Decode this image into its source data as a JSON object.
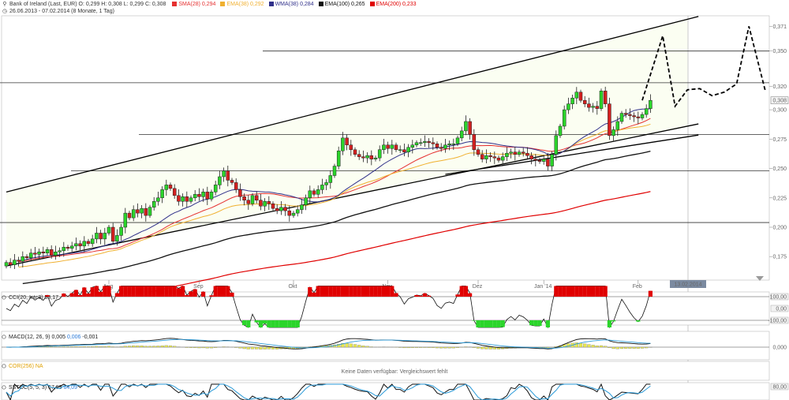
{
  "header": {
    "instrument": "Bank of Ireland (Last, EUR)",
    "ohlc": "O: 0,299  H: 0,308  L: 0,299  C: 0,308",
    "period": "26.06.2013 - 07.02.2014 (8 Monate, 1 Tag)",
    "indicators": [
      {
        "label": "SMA(28)",
        "value": "0,294",
        "color": "#e53030"
      },
      {
        "label": "EMA(38)",
        "value": "0,292",
        "color": "#f0b030"
      },
      {
        "label": "WMA(38)",
        "value": "0,284",
        "color": "#30308a"
      },
      {
        "label": "EMA(100)",
        "value": "0,265",
        "color": "#111111"
      },
      {
        "label": "EMA(200)",
        "value": "0,233",
        "color": "#e00000"
      }
    ]
  },
  "chart_data": [
    {
      "type": "candlestick",
      "name": "main",
      "ylim": [
        0.155,
        0.38
      ],
      "yticks": [
        "0,175",
        "0,200",
        "0,225",
        "0,250",
        "0,275",
        "0,300",
        "0,320",
        "0,350",
        "0,371"
      ],
      "ytick_values": [
        0.175,
        0.2,
        0.225,
        0.25,
        0.275,
        0.3,
        0.32,
        0.35,
        0.371
      ],
      "price_labels": [
        {
          "text": "0,308",
          "value": 0.308
        }
      ],
      "date_label": "13.02.2014",
      "x_months": [
        "Aug",
        "Sep",
        "Okt",
        "Nov",
        "Dez",
        "Jan '14",
        "Feb"
      ],
      "x_month_index": [
        25,
        47,
        70,
        93,
        115,
        131,
        154
      ],
      "closes": [
        0.17,
        0.168,
        0.172,
        0.171,
        0.175,
        0.174,
        0.178,
        0.177,
        0.179,
        0.178,
        0.181,
        0.176,
        0.179,
        0.18,
        0.183,
        0.182,
        0.184,
        0.186,
        0.184,
        0.188,
        0.186,
        0.19,
        0.195,
        0.19,
        0.195,
        0.2,
        0.188,
        0.193,
        0.2,
        0.212,
        0.208,
        0.215,
        0.212,
        0.216,
        0.21,
        0.217,
        0.222,
        0.225,
        0.232,
        0.236,
        0.233,
        0.227,
        0.222,
        0.226,
        0.222,
        0.225,
        0.228,
        0.226,
        0.23,
        0.224,
        0.23,
        0.236,
        0.243,
        0.248,
        0.24,
        0.238,
        0.232,
        0.226,
        0.223,
        0.22,
        0.227,
        0.223,
        0.218,
        0.222,
        0.22,
        0.216,
        0.214,
        0.217,
        0.214,
        0.21,
        0.212,
        0.215,
        0.219,
        0.225,
        0.231,
        0.228,
        0.232,
        0.236,
        0.238,
        0.244,
        0.252,
        0.265,
        0.276,
        0.27,
        0.266,
        0.262,
        0.26,
        0.259,
        0.261,
        0.258,
        0.259,
        0.266,
        0.27,
        0.267,
        0.27,
        0.266,
        0.266,
        0.264,
        0.268,
        0.27,
        0.272,
        0.272,
        0.273,
        0.272,
        0.271,
        0.268,
        0.267,
        0.27,
        0.271,
        0.271,
        0.276,
        0.282,
        0.29,
        0.279,
        0.266,
        0.262,
        0.258,
        0.261,
        0.26,
        0.259,
        0.257,
        0.26,
        0.263,
        0.264,
        0.262,
        0.264,
        0.263,
        0.261,
        0.258,
        0.257,
        0.256,
        0.258,
        0.252,
        0.262,
        0.278,
        0.286,
        0.3,
        0.305,
        0.31,
        0.315,
        0.308,
        0.305,
        0.302,
        0.303,
        0.301,
        0.316,
        0.305,
        0.278,
        0.283,
        0.29,
        0.297,
        0.296,
        0.295,
        0.294,
        0.293,
        0.296,
        0.301,
        0.308
      ],
      "channel": [
        {
          "from": [
            0,
            0.23
          ],
          "to": [
            166,
            0.377
          ],
          "color": "#111111"
        },
        {
          "from": [
            0,
            0.167
          ],
          "to": [
            166,
            0.286
          ],
          "color": "#111111"
        },
        {
          "from": [
            107,
            0.245
          ],
          "to": [
            166,
            0.277
          ],
          "color": "#111111"
        }
      ],
      "horizontal_lines": [
        0.35,
        0.323,
        0.279,
        0.248,
        0.204
      ],
      "projection": [
        [
          155,
          0.308
        ],
        [
          160,
          0.363
        ],
        [
          163,
          0.303
        ],
        [
          166,
          0.317
        ],
        [
          169,
          0.318
        ],
        [
          172,
          0.312
        ],
        [
          175,
          0.315
        ],
        [
          178,
          0.322
        ],
        [
          181,
          0.371
        ],
        [
          185,
          0.316
        ]
      ]
    },
    {
      "type": "line",
      "name": "CCI",
      "title": "CCI(20, Intc3)",
      "value": "53,17",
      "ylabels": [
        "100,00",
        "0,00",
        "-100,00"
      ]
    },
    {
      "type": "bar",
      "name": "MACD",
      "title": "MACD(12, 26, 9)",
      "values": [
        "0,005",
        "0,006",
        "-0,001"
      ],
      "ylabels": [
        "0,000"
      ]
    },
    {
      "type": "line",
      "name": "COR",
      "title": "COR(256)",
      "value": "NA",
      "notice": "Keine Daten verfügbar: Vergleichswert fehlt"
    },
    {
      "type": "line",
      "name": "SSTOC",
      "title": "SSTOC(5, 5, 3)",
      "values": [
        "67,99",
        "64,09"
      ],
      "ylabels": [
        "80,00"
      ]
    }
  ]
}
